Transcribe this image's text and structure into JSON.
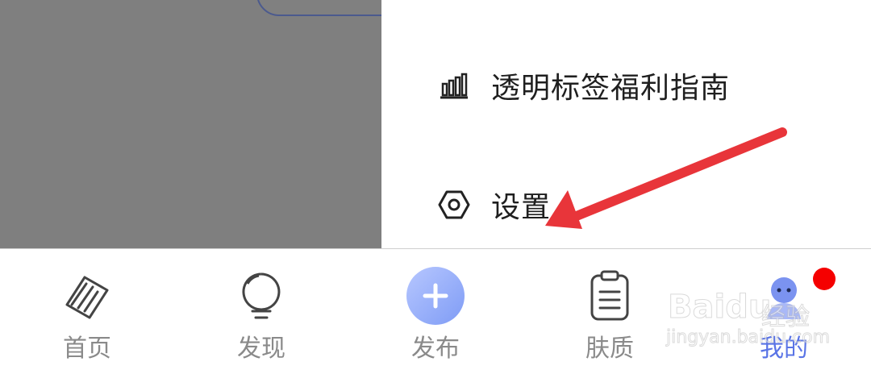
{
  "menu": {
    "items": [
      {
        "label": "透明标签福利指南",
        "icon": "bar-chart-icon"
      },
      {
        "label": "设置",
        "icon": "hexagon-settings-icon"
      }
    ]
  },
  "bottom_nav": {
    "tabs": [
      {
        "label": "首页",
        "icon": "leaf-icon",
        "active": false
      },
      {
        "label": "发现",
        "icon": "lightbulb-icon",
        "active": false
      },
      {
        "label": "发布",
        "icon": "plus-icon",
        "active": false
      },
      {
        "label": "肤质",
        "icon": "clipboard-icon",
        "active": false
      },
      {
        "label": "我的",
        "icon": "user-avatar-icon",
        "active": true
      }
    ]
  },
  "watermark": {
    "main": "Baidu",
    "sub": "经验",
    "url": "jingyan.baidu.com"
  },
  "colors": {
    "overlay": "#7f7f7f",
    "active_tab": "#5a74e6",
    "inactive_tab": "#8a8a8a",
    "annotation_arrow": "#e8353a",
    "notification_dot": "#f50000",
    "publish_gradient_start": "#b7c7ff",
    "publish_gradient_end": "#7f9cf5"
  }
}
